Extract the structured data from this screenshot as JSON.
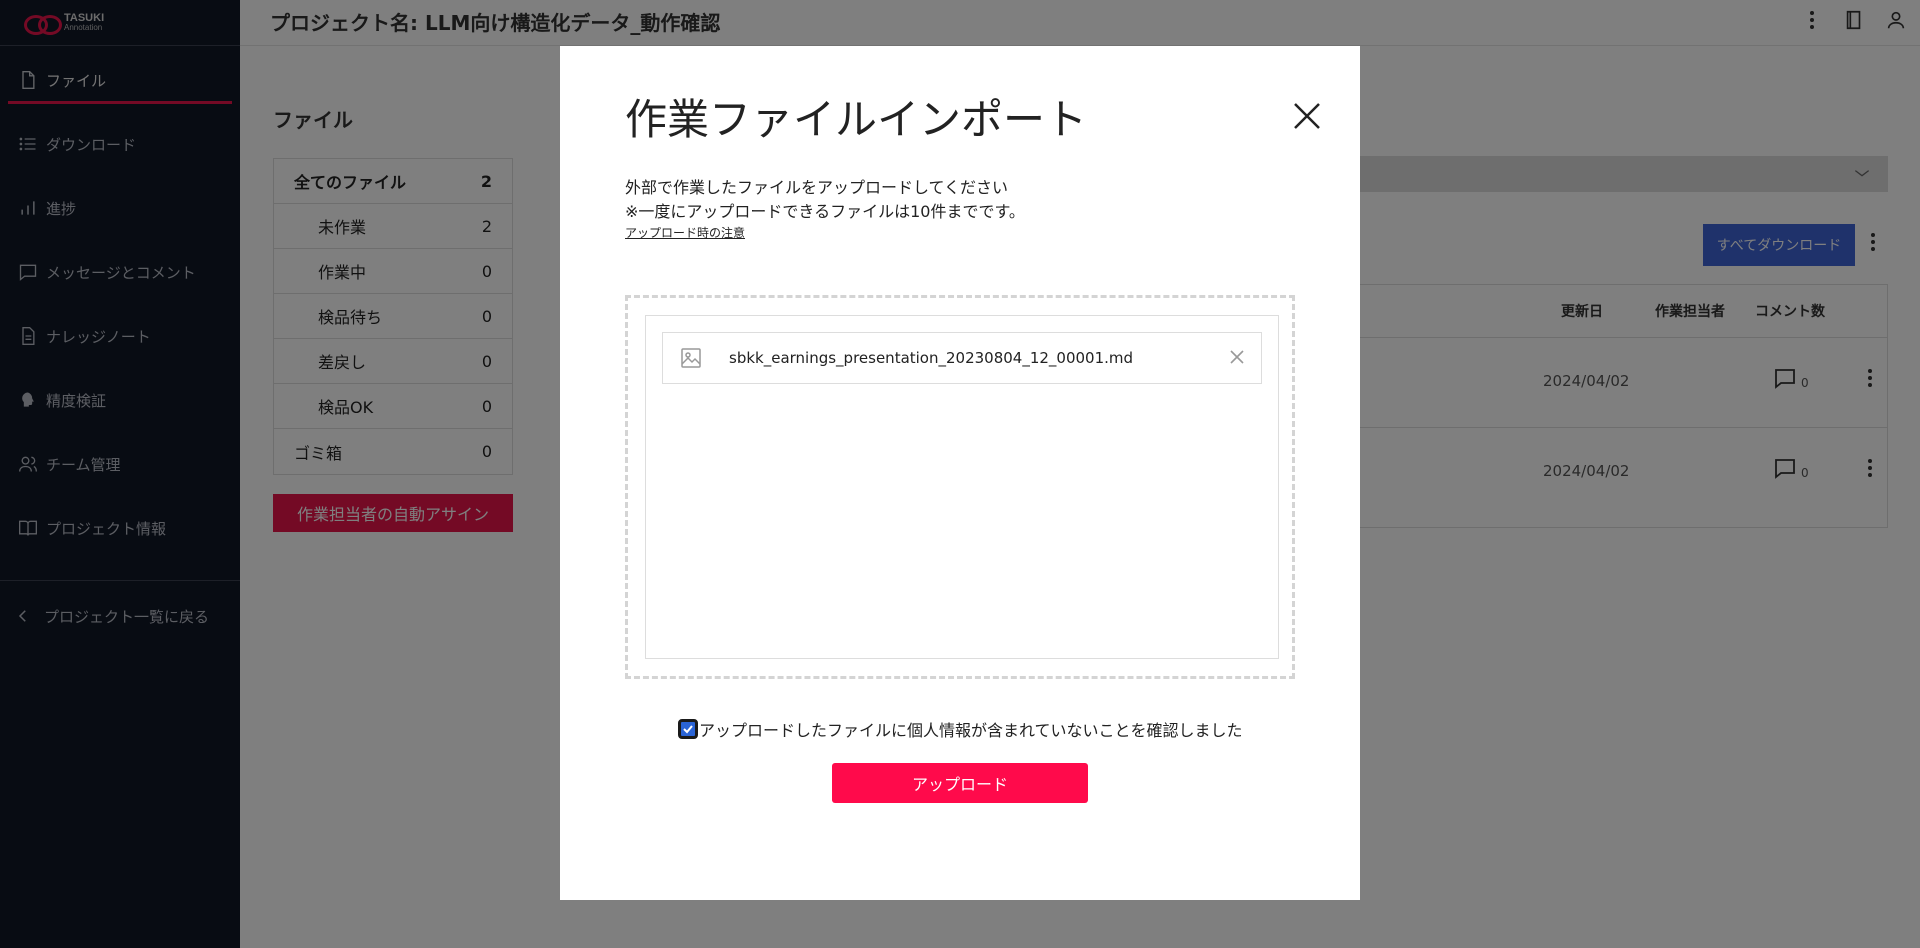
{
  "brand": {
    "name": "TASUKI",
    "sub": "Annotation",
    "accent": "#e8154b"
  },
  "header": {
    "project_title": "プロジェクト名: LLM向け構造化データ_動作確認"
  },
  "sidebar": {
    "items": [
      {
        "label": "ファイル",
        "icon": "file-icon",
        "active": true
      },
      {
        "label": "ダウンロード",
        "icon": "list-icon"
      },
      {
        "label": "進捗",
        "icon": "bar-chart-icon"
      },
      {
        "label": "メッセージとコメント",
        "icon": "chat-icon"
      },
      {
        "label": "ナレッジノート",
        "icon": "note-icon"
      },
      {
        "label": "精度検証",
        "icon": "brain-icon"
      },
      {
        "label": "チーム管理",
        "icon": "team-icon"
      },
      {
        "label": "プロジェクト情報",
        "icon": "book-icon"
      }
    ],
    "back_label": "プロジェクト一覧に戻る"
  },
  "main": {
    "files_heading": "ファイル",
    "status": [
      {
        "label": "全てのファイル",
        "count": "2"
      },
      {
        "label": "未作業",
        "count": "2"
      },
      {
        "label": "作業中",
        "count": "0"
      },
      {
        "label": "検品待ち",
        "count": "0"
      },
      {
        "label": "差戻し",
        "count": "0"
      },
      {
        "label": "検品OK",
        "count": "0"
      },
      {
        "label": "ゴミ箱",
        "count": "0"
      }
    ],
    "assign_button": "作業担当者の自動アサイン",
    "download_all_button": "すべてダウンロード",
    "table": {
      "headers": [
        "更新日",
        "作業担当者",
        "コメント数"
      ],
      "rows": [
        {
          "date": "2024/04/02",
          "comments": "0"
        },
        {
          "date": "2024/04/02",
          "comments": "0"
        }
      ]
    }
  },
  "modal": {
    "title": "作業ファイルインポート",
    "desc_line1": "外部で作業したファイルをアップロードしてください",
    "desc_line2": "※一度にアップロードできるファイルは10件までです。",
    "note_link": "アップロード時の注意",
    "files": [
      {
        "name": "sbkk_earnings_presentation_20230804_12_00001.md"
      }
    ],
    "confirm_label": "アップロードしたファイルに個人情報が含まれていないことを確認しました",
    "confirm_checked": true,
    "upload_button": "アップロード"
  }
}
